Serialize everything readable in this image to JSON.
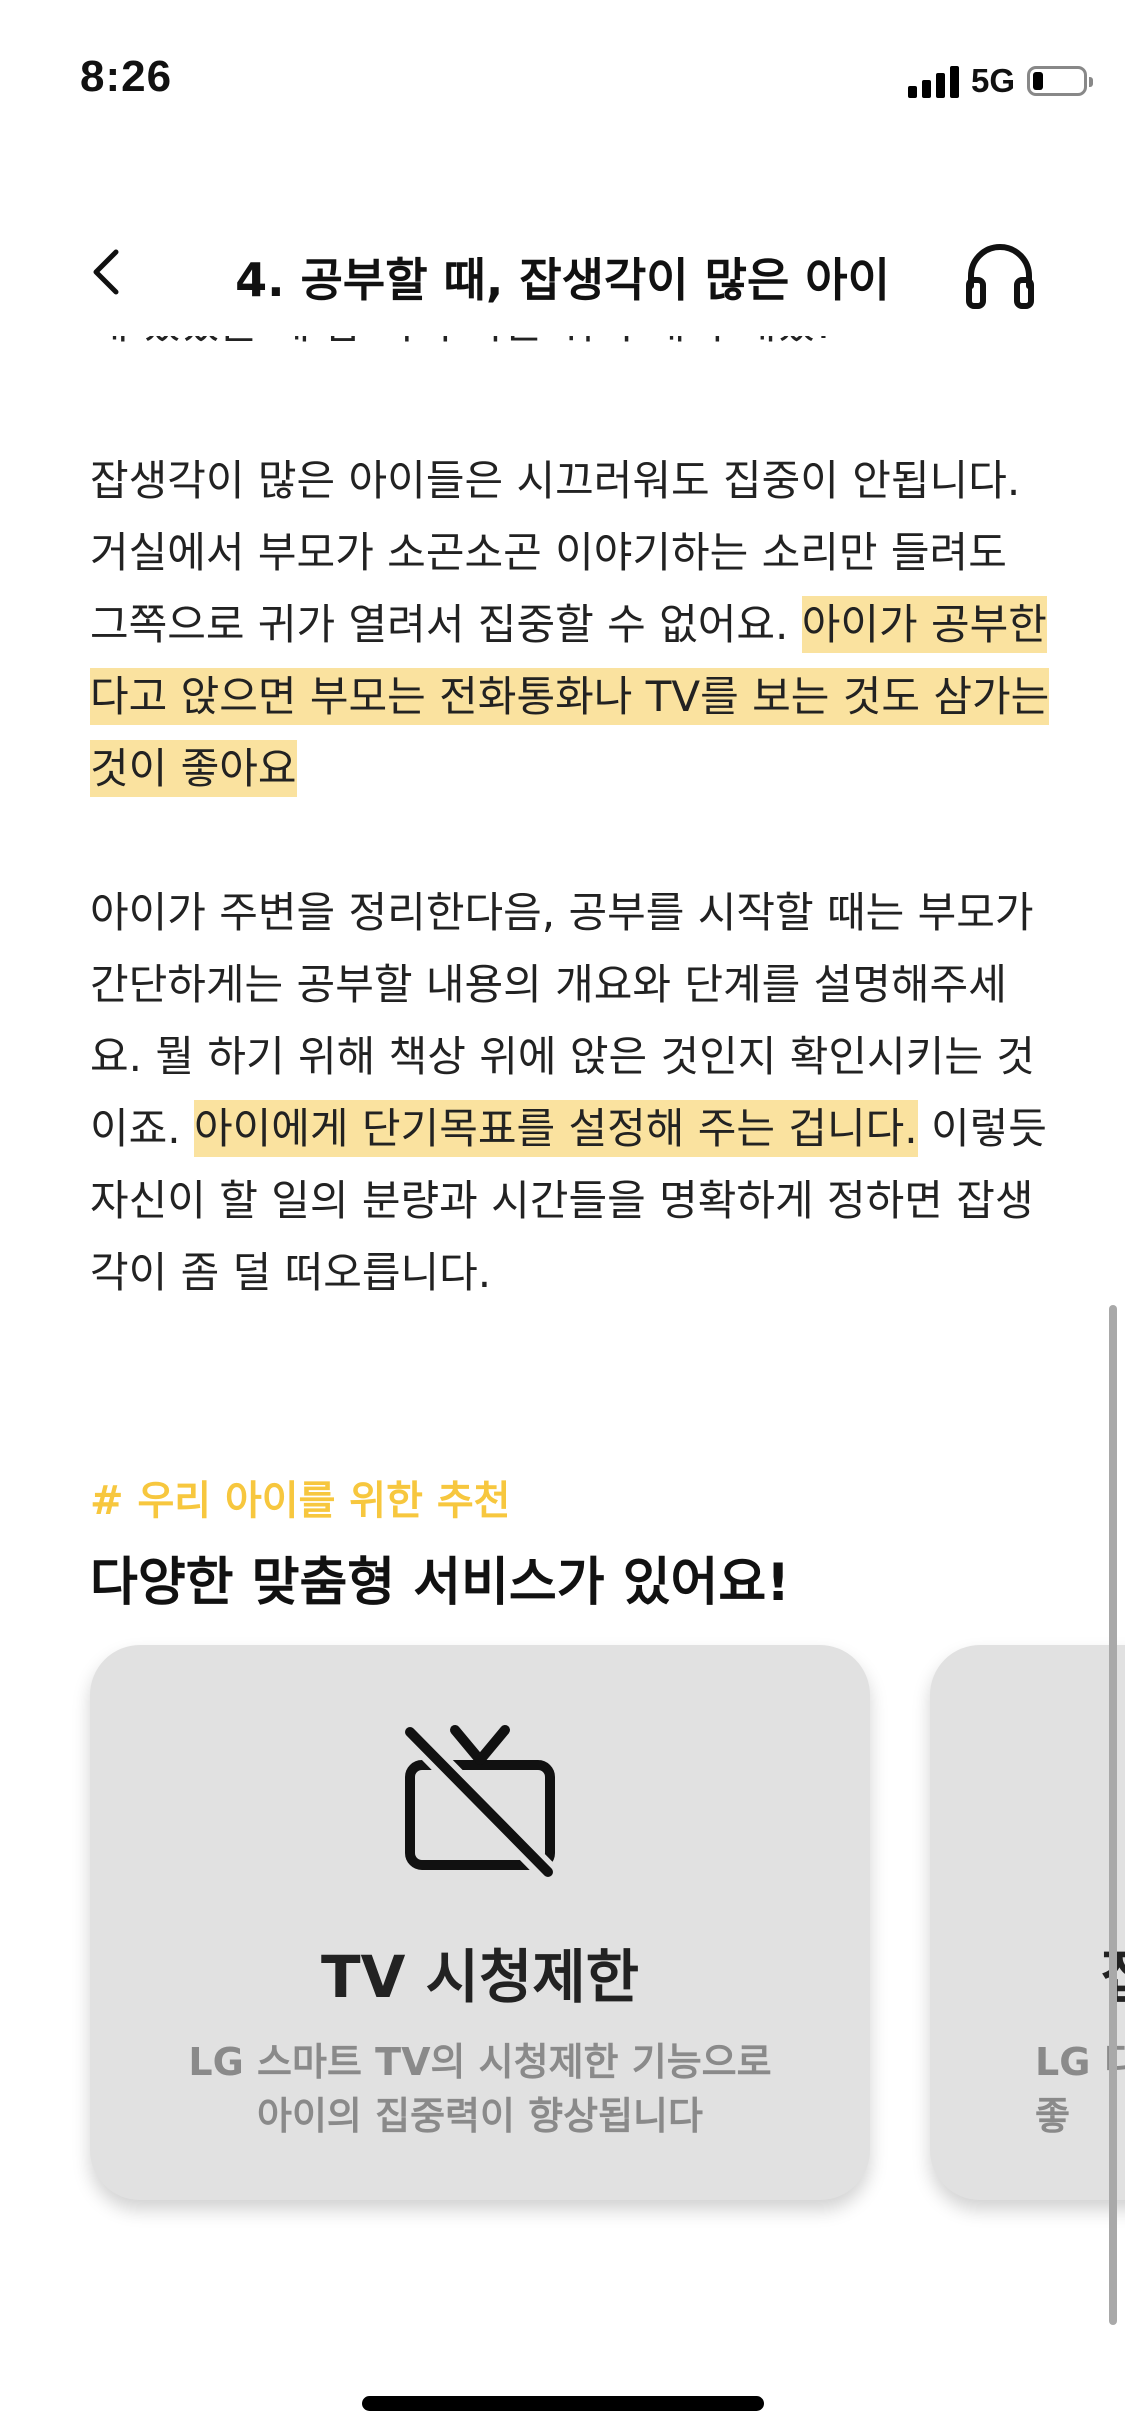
{
  "status_bar": {
    "time": "8:26",
    "network": "5G",
    "signal_icon": "signal-bars-icon",
    "battery_icon": "battery-icon"
  },
  "header": {
    "title": "4. 공부할 때, 잡생각이 많은 아이",
    "back_icon": "chevron-left-icon",
    "audio_icon": "headphones-icon"
  },
  "article": {
    "cut_line": "재 있었을 때 참 역시 하는 쉬지 해서 재밌!",
    "p1_normal": "잡생각이 많은 아이들은 시끄러워도 집중이 안됩니다. 거실에서 부모가 소곤소곤 이야기하는 소리만 들려도 그쪽으로 귀가 열려서 집중할 수 없어요.",
    "p1_highlight": "아이가 공부한다고 앉으면 부모는 전화통화나 TV를 보는 것도 삼가는 것이 좋아요",
    "p2_normal_1": "아이가 주변을 정리한다음, 공부를 시작할 때는 부모가 간단하게는 공부할 내용의 개요와 단계를 설명해주세요. 뭘 하기 위해 책상 위에 앉은 것인지 확인시키는 것이죠.",
    "p2_highlight": "아이에게 단기목표를 설정해 주는 겁니다.",
    "p2_normal_2": "이렇듯 자신이 할 일의 분량과 시간들을 명확하게 정하면 잡생각이 좀 덜 떠오릅니다."
  },
  "recommend": {
    "tag": "# 우리 아이를 위한 추천",
    "title": "다양한 맞춤형 서비스가 있어요!",
    "cards": [
      {
        "icon": "tv-off-icon",
        "title": "TV 시청제한",
        "desc_line1": "LG 스마트 TV의 시청제한 기능으로",
        "desc_line2": "아이의 집중력이 향상됩니다"
      },
      {
        "title": "집",
        "desc_line1": "LG 디",
        "desc_line2": "좋"
      }
    ]
  },
  "colors": {
    "highlight": "#fae29f",
    "accent": "#f7c73e",
    "card_bg": "#e1e1e1",
    "card_desc": "#8a8a8a"
  }
}
